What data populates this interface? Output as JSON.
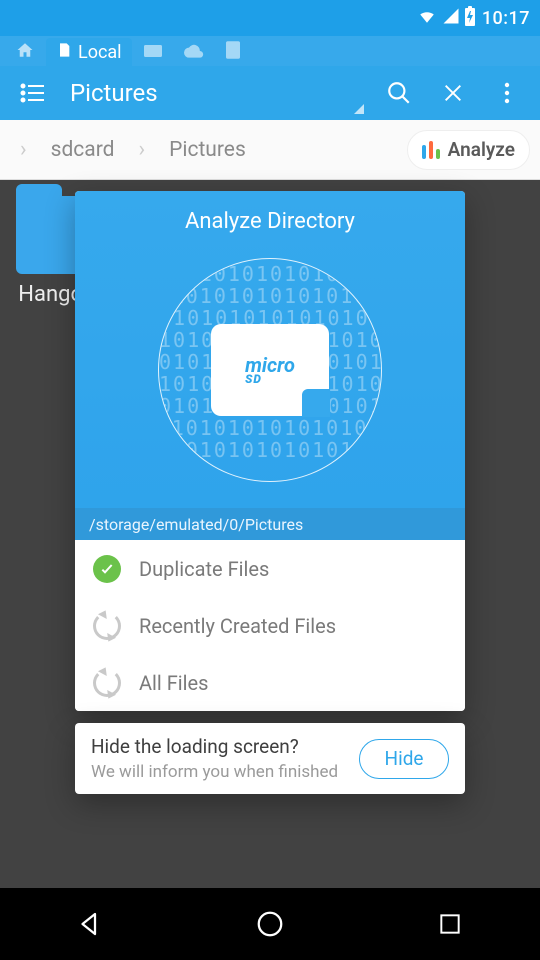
{
  "status": {
    "time": "10:17"
  },
  "tabs": {
    "home_icon": "home",
    "local_label": "Local",
    "extra_icons": [
      "square",
      "cloud",
      "square2"
    ]
  },
  "appbar": {
    "title": "Pictures"
  },
  "breadcrumb": {
    "items": [
      "sdcard",
      "Pictures"
    ],
    "analyze_label": "Analyze"
  },
  "content": {
    "folder_name": "Hangouts"
  },
  "dialog": {
    "title": "Analyze Directory",
    "sd_brand_top": "micro",
    "sd_brand_bottom": "SD",
    "path": "/storage/emulated/0/Pictures",
    "items": [
      {
        "state": "ok",
        "label": "Duplicate Files"
      },
      {
        "state": "spin",
        "label": "Recently Created Files"
      },
      {
        "state": "spin",
        "label": "All Files"
      }
    ]
  },
  "hide_card": {
    "title": "Hide the loading screen?",
    "subtitle": "We will inform you when finished",
    "button": "Hide"
  }
}
